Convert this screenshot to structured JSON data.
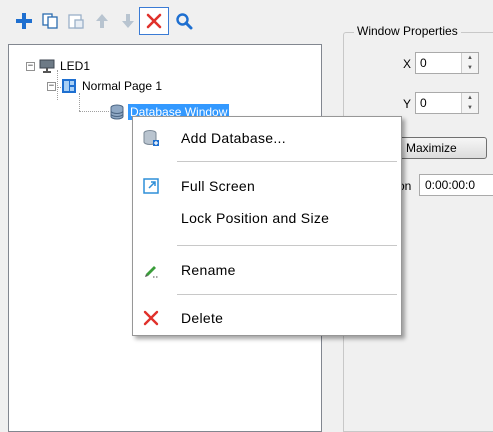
{
  "toolbar": {
    "buttons": [
      {
        "name": "add-icon"
      },
      {
        "name": "copy-icon"
      },
      {
        "name": "paste-icon"
      },
      {
        "name": "move-up-icon"
      },
      {
        "name": "move-down-icon"
      },
      {
        "name": "delete-icon"
      },
      {
        "name": "search-icon"
      }
    ]
  },
  "tree": {
    "root": {
      "label": "LED1",
      "expander": "−"
    },
    "page": {
      "label": "Normal Page 1",
      "expander": "−"
    },
    "window": {
      "label": "Database Window"
    }
  },
  "properties": {
    "group_title": "Window Properties",
    "x_label": "X",
    "x_value": "0",
    "y_label": "Y",
    "y_value": "0",
    "maximize_label": "Maximize",
    "duration_label_partial": "on",
    "duration_value": "0:00:00:0"
  },
  "context_menu": {
    "items": {
      "add_database": "Add Database...",
      "full_screen": "Full Screen",
      "lock_position": "Lock Position and Size",
      "rename": "Rename",
      "delete": "Delete"
    }
  },
  "colors": {
    "accent_blue": "#1e6fd0",
    "selection": "#3399ff",
    "delete_red": "#e0312b"
  }
}
